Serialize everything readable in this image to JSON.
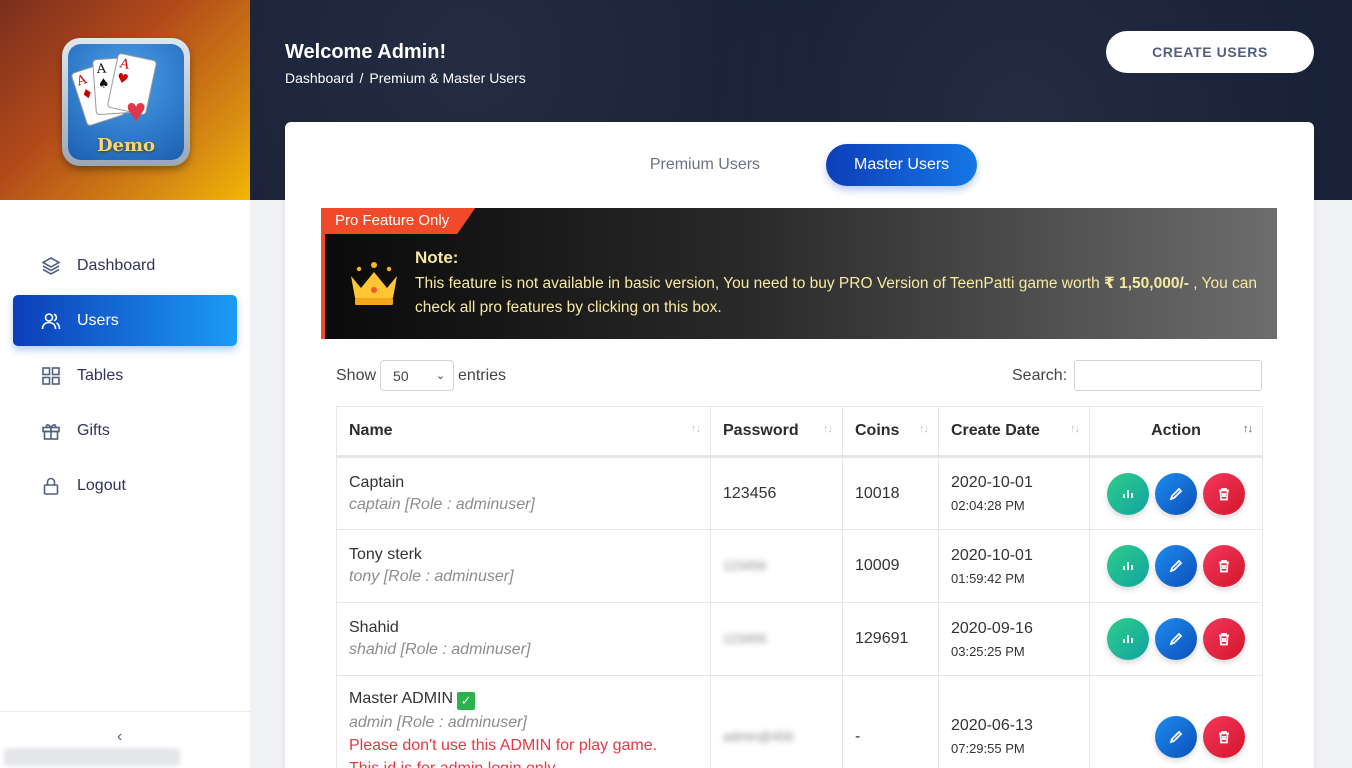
{
  "brand": {
    "logo_text": "Demo"
  },
  "sidebar": {
    "items": [
      {
        "label": "Dashboard",
        "icon": "layers-icon"
      },
      {
        "label": "Users",
        "icon": "users-icon",
        "active": true
      },
      {
        "label": "Tables",
        "icon": "grid-icon"
      },
      {
        "label": "Gifts",
        "icon": "gift-icon"
      },
      {
        "label": "Logout",
        "icon": "lock-icon"
      }
    ],
    "collapse_glyph": "‹"
  },
  "header": {
    "welcome": "Welcome Admin!",
    "breadcrumb": [
      "Dashboard",
      "Premium & Master Users"
    ],
    "breadcrumb_sep": "/",
    "create_button": "CREATE USERS"
  },
  "tabs": [
    {
      "label": "Premium Users",
      "active": false
    },
    {
      "label": "Master Users",
      "active": true
    }
  ],
  "pro_banner": {
    "tag": "Pro Feature Only",
    "title": "Note:",
    "text_before": "This feature is not available in basic version, You need to buy PRO Version of TeenPatti game worth ",
    "price": "₹ 1,50,000/-",
    "text_after": " , You can check all pro features by clicking on this box."
  },
  "table_controls": {
    "show_label": "Show",
    "entries_value": "50",
    "entries_label": "entries",
    "search_label": "Search:"
  },
  "table": {
    "columns": [
      "Name",
      "Password",
      "Coins",
      "Create Date",
      "Action"
    ],
    "rows": [
      {
        "name": "Captain",
        "role": "captain [Role : adminuser]",
        "password": "123456",
        "coins": "10018",
        "date": "2020-10-01",
        "time": "02:04:28 PM"
      },
      {
        "name": "Tony sterk",
        "role": "tony [Role : adminuser]",
        "password": "123456",
        "coins": "10009",
        "date": "2020-10-01",
        "time": "01:59:42 PM"
      },
      {
        "name": "Shahid",
        "role": "shahid [Role : adminuser]",
        "password": "123456",
        "coins": "129691",
        "date": "2020-09-16",
        "time": "03:25:25 PM"
      },
      {
        "name": "Master ADMIN",
        "role": "admin [Role : adminuser]",
        "password": "admin@456",
        "coins": "-",
        "date": "2020-06-13",
        "time": "07:29:55 PM",
        "warning": "Please don't use this ADMIN for play game.",
        "warning2": "This id is for admin login only"
      }
    ]
  },
  "colors": {
    "primary": "#0d3eb8",
    "accent": "#1b9bf5",
    "danger": "#f5365c",
    "success": "#2dce89",
    "pro_orange": "#f04a2a"
  }
}
